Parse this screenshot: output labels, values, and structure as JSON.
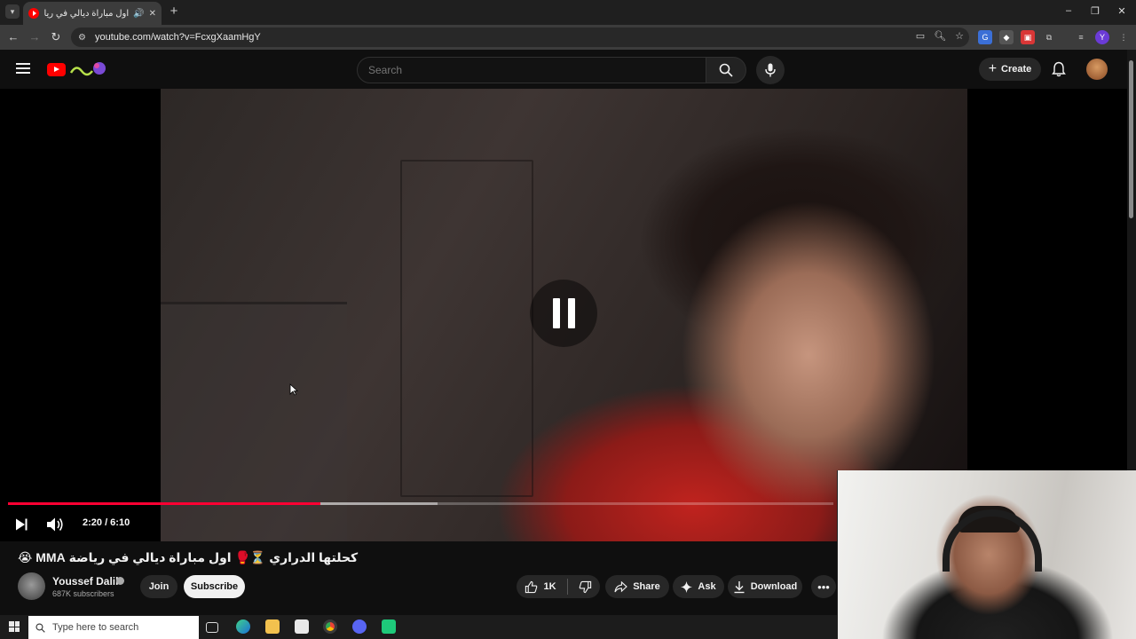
{
  "browser": {
    "tab_title": "اول مباراة ديالي في رياضة MMA",
    "url": "youtube.com/watch?v=FcxgXaamHgY",
    "new_tab_symbol": "+",
    "window_controls": [
      "–",
      "❐",
      "✕"
    ]
  },
  "youtube": {
    "search_placeholder": "Search",
    "create_label": "Create",
    "video": {
      "current_time": "2:20",
      "duration": "6:10",
      "time_display": "2:20 / 6:10",
      "progress_fraction": 0.378,
      "buffered_fraction": 0.52,
      "state": "paused-indicator"
    },
    "title": "كحلتها الدراري ⏳🥊 اول مباراة ديالي في رياضة MMA 😭",
    "channel": {
      "name": "Youssef Dalil",
      "subscribers": "687K subscribers",
      "join_label": "Join",
      "subscribe_label": "Subscribe"
    },
    "actions": {
      "like_count": "1K",
      "share_label": "Share",
      "ask_label": "Ask",
      "download_label": "Download",
      "more_symbol": "•••"
    }
  },
  "taskbar": {
    "search_placeholder": "Type here to search"
  },
  "colors": {
    "accent_red": "#ff0033",
    "background": "#0f0f0f"
  }
}
